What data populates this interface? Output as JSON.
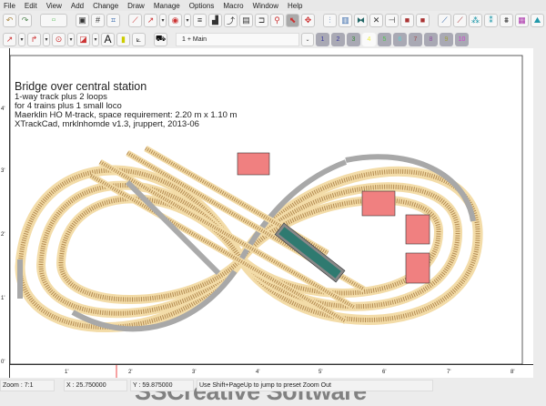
{
  "menu": [
    "File",
    "Edit",
    "View",
    "Add",
    "Change",
    "Draw",
    "Manage",
    "Options",
    "Macro",
    "Window",
    "Help"
  ],
  "toolbar": {
    "layer_select": "1 + Main",
    "layers": [
      "1",
      "2",
      "3",
      "4",
      "5",
      "6",
      "7",
      "8",
      "9",
      "10"
    ],
    "layer_colors": [
      "#3a3aa0",
      "#3a3aa0",
      "#3a8a3a",
      "#ffff60",
      "#50c050",
      "#60d0d0",
      "#a05050",
      "#9050a0",
      "#a0a040",
      "#d040d0"
    ]
  },
  "drawing": {
    "title": "Bridge over central station",
    "lines": [
      "1-way track plus 2 loops",
      "for 4 trains plus 1 small loco",
      "Maerklin HO M-track, space requirement: 2.20 m x 1.10 m",
      "XTrackCad, mrklnhomde v1.3, jruppert, 2013-06"
    ]
  },
  "rulers": {
    "left": [
      "1'",
      "2'",
      "3'",
      "4'"
    ],
    "bottom": [
      "0'",
      "1'",
      "2'",
      "3'",
      "4'",
      "5'",
      "6'",
      "7'",
      "8'"
    ]
  },
  "status": {
    "zoom": "Zoom : 7:1",
    "x": "X : 25.750000",
    "y": "Y : 59.875000",
    "message": "Use Shift+PageUp to jump to preset Zoom Out"
  },
  "watermark": "SSCreative Software",
  "colors": {
    "track": "#e0b060",
    "rail": "#8a6a40",
    "sectional": "#a8a8a8",
    "building": "#f08080",
    "platform": "#2f7a70"
  }
}
